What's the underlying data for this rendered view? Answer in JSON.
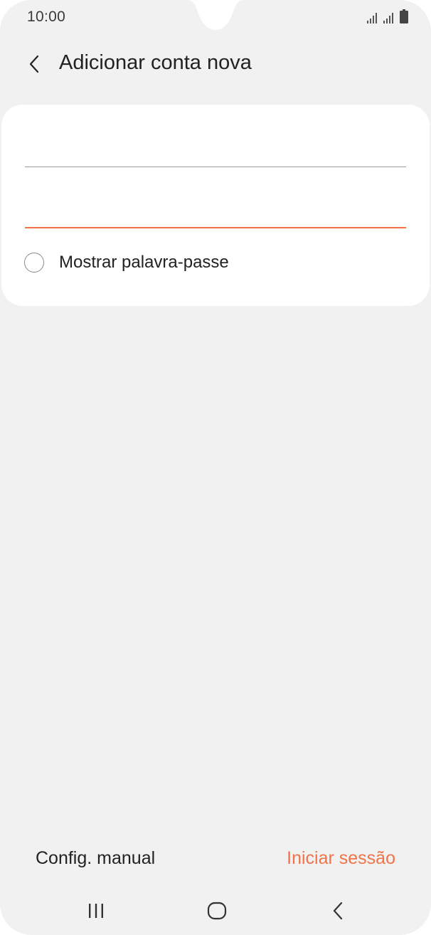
{
  "status_bar": {
    "time": "10:00",
    "icons": [
      "signal-icon",
      "signal-icon",
      "battery-icon"
    ]
  },
  "header": {
    "back_icon": "chevron-left-icon",
    "title": "Adicionar conta nova"
  },
  "form": {
    "email": {
      "value": "",
      "placeholder": ""
    },
    "password": {
      "value": "",
      "placeholder": ""
    },
    "show_password": {
      "label": "Mostrar palavra-passe",
      "checked": false
    }
  },
  "actions": {
    "manual_label": "Config. manual",
    "signin_label": "Iniciar sessão"
  },
  "colors": {
    "accent": "#f0734a",
    "background": "#f1f1f1",
    "card": "#ffffff",
    "text": "#222222"
  },
  "navbar": {
    "recents_icon": "recents-icon",
    "home_icon": "home-icon",
    "back_icon": "back-icon"
  }
}
